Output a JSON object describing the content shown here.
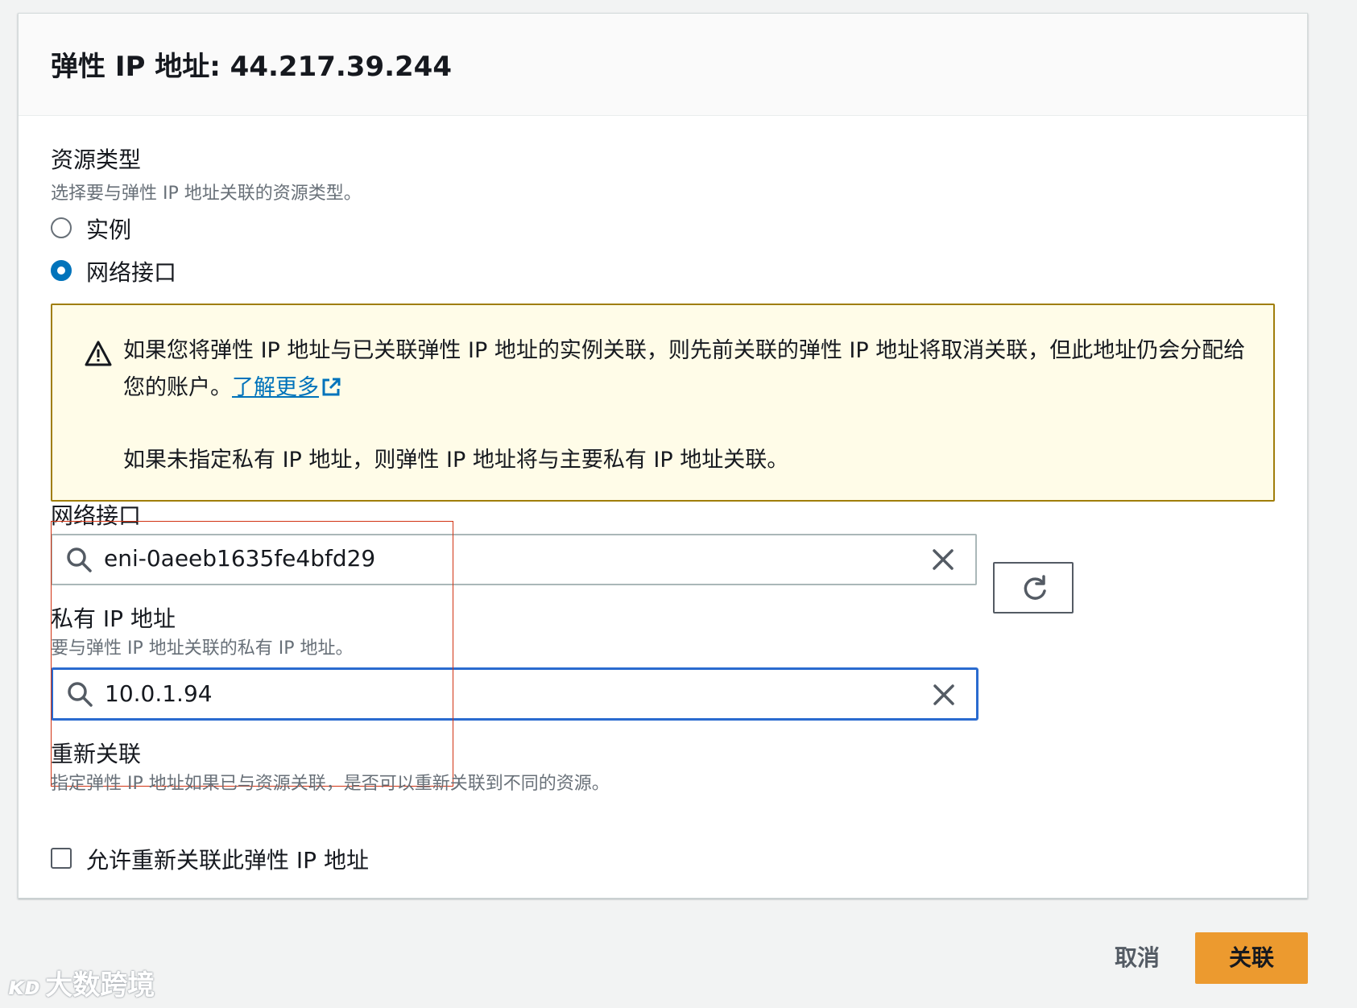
{
  "panel": {
    "title": "弹性 IP 地址: 44.217.39.244"
  },
  "resource_type": {
    "label": "资源类型",
    "description": "选择要与弹性 IP 地址关联的资源类型。",
    "options": [
      {
        "label": "实例",
        "selected": false
      },
      {
        "label": "网络接口",
        "selected": true
      }
    ]
  },
  "alert": {
    "text": "如果您将弹性 IP 地址与已关联弹性 IP 地址的实例关联，则先前关联的弹性 IP 地址将取消关联，但此地址仍会分配给您的账户。",
    "link": "了解更多",
    "text2": "如果未指定私有 IP 地址，则弹性 IP 地址将与主要私有 IP 地址关联。"
  },
  "network_interface": {
    "label": "网络接口",
    "value": "eni-0aeeb1635fe4bfd29"
  },
  "private_ip": {
    "label": "私有 IP 地址",
    "description": "要与弹性 IP 地址关联的私有 IP 地址。",
    "value": "10.0.1.94"
  },
  "reassociate": {
    "label": "重新关联",
    "description": "指定弹性 IP 地址如果已与资源关联，是否可以重新关联到不同的资源。",
    "checkbox_label": "允许重新关联此弹性 IP 地址",
    "checked": false
  },
  "footer": {
    "cancel_label": "取消",
    "associate_label": "关联"
  },
  "watermark": {
    "logo": "ᴋᴅ",
    "text": "大数跨境"
  },
  "colors": {
    "accent": "#0073bb",
    "primary_button": "#ec9a2f",
    "alert_bg": "#fffce8",
    "alert_border": "#a07e0a",
    "focus_border": "#2a6bcf",
    "highlight_box": "#d13212"
  }
}
